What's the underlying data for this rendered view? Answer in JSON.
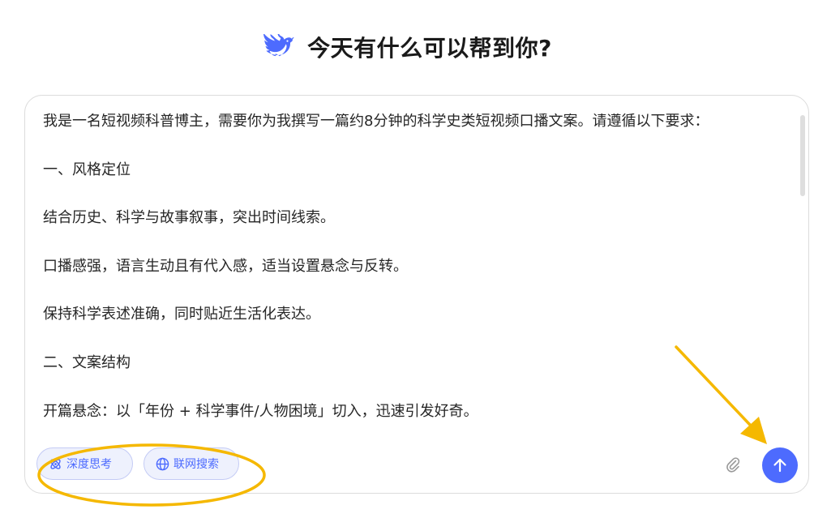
{
  "header": {
    "title": "今天有什么可以帮到你?"
  },
  "input": {
    "lines": [
      "我是一名短视频科普博主，需要你为我撰写一篇约8分钟的科学史类短视频口播文案。请遵循以下要求：",
      "一、风格定位",
      "结合历史、科学与故事叙事，突出时间线索。",
      "口播感强，语言生动且有代入感，适当设置悬念与反转。",
      "保持科学表述准确，同时贴近生活化表达。",
      "二、文案结构",
      "开篇悬念：以「年份 + 科学事件/人物困境」切入，迅速引发好奇。"
    ]
  },
  "controls": {
    "deep_think_label": "深度思考",
    "web_search_label": "联网搜索"
  },
  "icons": {
    "logo": "deepseek-whale-logo",
    "deep_think": "atom-icon",
    "web_search": "globe-icon",
    "attach": "paperclip-icon",
    "send": "arrow-up-icon"
  },
  "colors": {
    "accent": "#4d6bfe",
    "chip_bg": "#eef1fd",
    "annotation": "#f5b800"
  }
}
